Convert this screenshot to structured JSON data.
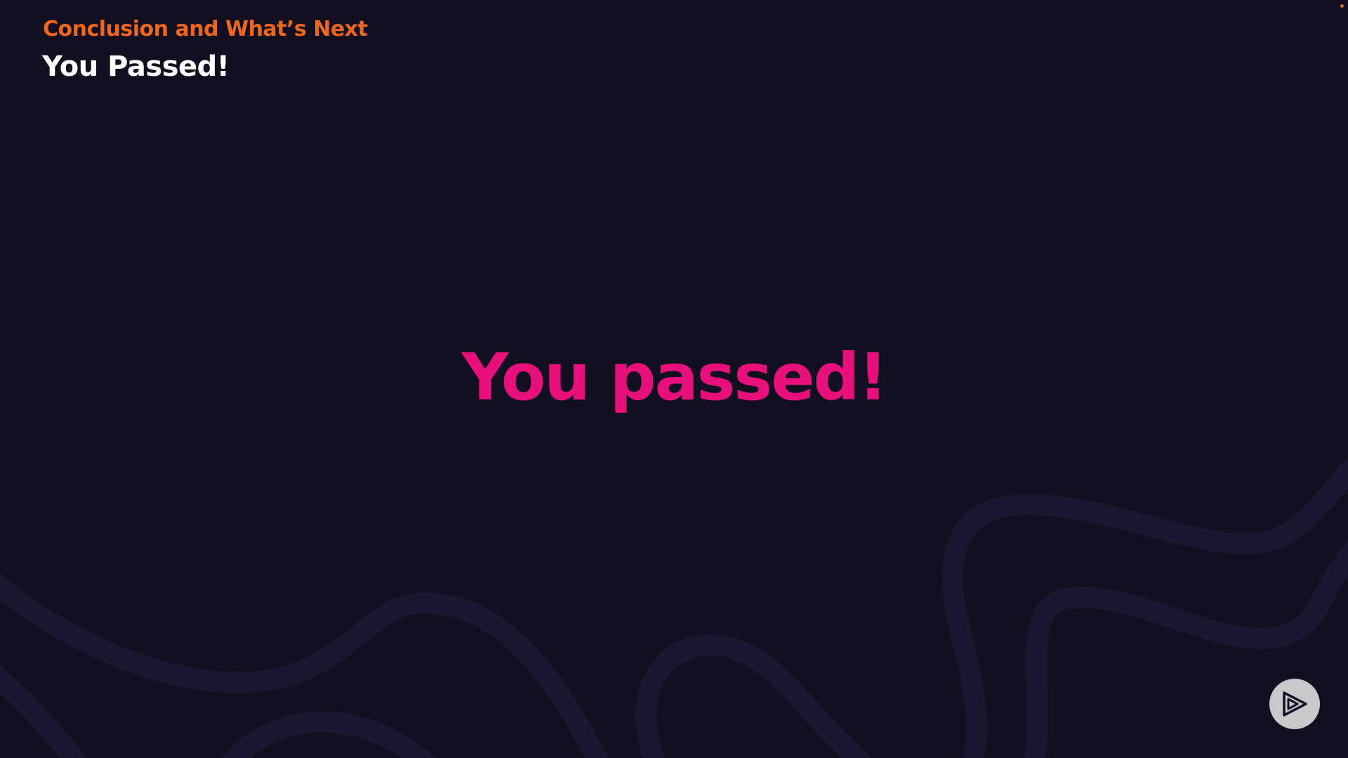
{
  "slide": {
    "section_title": "Conclusion and What’s Next",
    "title": "You Passed!",
    "headline": "You passed!"
  },
  "controls": {
    "play_icon": "play-icon"
  },
  "colors": {
    "background": "#121020",
    "section_title": "#f0661c",
    "title": "#ffffff",
    "headline": "#e8107a",
    "wave": "#1c1934",
    "play_button": "#c9c9cc"
  }
}
